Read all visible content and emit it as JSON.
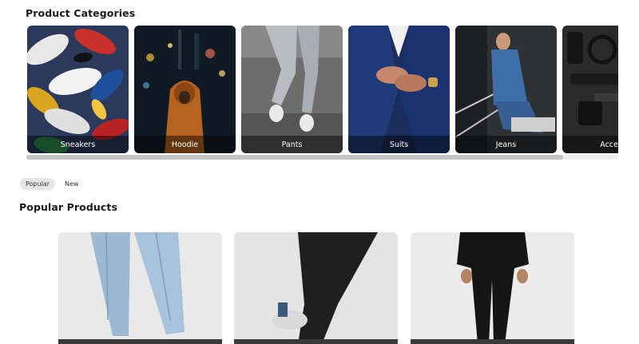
{
  "categories": {
    "title": "Product Categories",
    "items": [
      {
        "label": "Sneakers"
      },
      {
        "label": "Hoodie"
      },
      {
        "label": "Pants"
      },
      {
        "label": "Suits"
      },
      {
        "label": "Jeans"
      },
      {
        "label": "Access"
      }
    ]
  },
  "filters": {
    "popular_label": "Popular",
    "new_label": "New",
    "active": "Popular"
  },
  "popular": {
    "title": "Popular Products"
  },
  "colors": {
    "chip_active_bg": "#e6e6e6",
    "label_overlay": "rgba(0,0,0,0.45)",
    "scrollbar_thumb": "#c4c4c4"
  }
}
